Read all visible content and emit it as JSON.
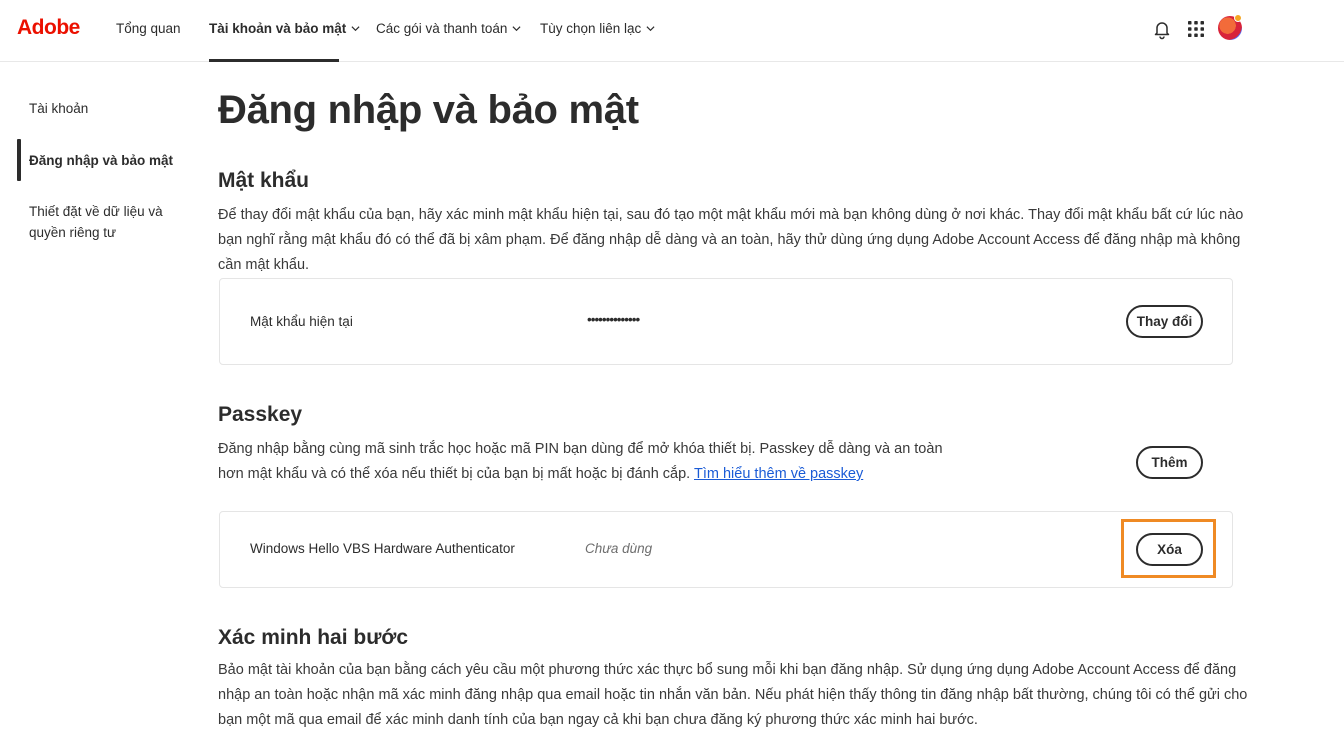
{
  "header": {
    "logo": "Adobe",
    "nav": [
      {
        "label": "Tổng quan"
      },
      {
        "label": "Tài khoản và bảo mật"
      },
      {
        "label": "Các gói và thanh toán"
      },
      {
        "label": "Tùy chọn liên lạc"
      }
    ],
    "icons": [
      "bell-icon",
      "apps-grid-icon",
      "avatar"
    ]
  },
  "sidebar": {
    "items": [
      {
        "label": "Tài khoản"
      },
      {
        "label": "Đăng nhập và bảo mật"
      },
      {
        "label": "Thiết đặt về dữ liệu và quyền riêng tư"
      }
    ]
  },
  "main": {
    "title": "Đăng nhập và bảo mật",
    "password": {
      "heading": "Mật khẩu",
      "description": "Để thay đổi mật khẩu của bạn, hãy xác minh mật khẩu hiện tại, sau đó tạo một mật khẩu mới mà bạn không dùng ở nơi khác. Thay đổi mật khẩu bất cứ lúc nào bạn nghĩ rằng mật khẩu đó có thể đã bị xâm phạm. Để đăng nhập dễ dàng và an toàn, hãy thử dùng ứng dụng Adobe Account Access để đăng nhập mà không cần mật khẩu.",
      "current_label": "Mật khẩu hiện tại",
      "current_value": "••••••••••••••",
      "change_button": "Thay đổi"
    },
    "passkey": {
      "heading": "Passkey",
      "description": "Đăng nhập bằng cùng mã sinh trắc học hoặc mã PIN bạn dùng để mở khóa thiết bị. Passkey dễ dàng và an toàn hơn mật khẩu và có thể xóa nếu thiết bị của bạn bị mất hoặc bị đánh cắp.",
      "learn_more": "Tìm hiểu thêm về passkey",
      "add_button": "Thêm",
      "device_name": "Windows Hello VBS Hardware Authenticator",
      "device_status": "Chưa dùng",
      "remove_button": "Xóa"
    },
    "two_step": {
      "heading": "Xác minh hai bước",
      "description": "Bảo mật tài khoản của bạn bằng cách yêu cầu một phương thức xác thực bổ sung mỗi khi bạn đăng nhập. Sử dụng ứng dụng Adobe Account Access để đăng nhập an toàn hoặc nhận mã xác minh đăng nhập qua email hoặc tin nhắn văn bản. Nếu phát hiện thấy thông tin đăng nhập bất thường, chúng tôi có thể gửi cho bạn một mã qua email để xác minh danh tính của bạn ngay cả khi bạn chưa đăng ký phương thức xác minh hai bước."
    }
  },
  "colors": {
    "brand": "#eb1000",
    "link": "#1a5bd6",
    "highlight": "#ef8a24"
  }
}
